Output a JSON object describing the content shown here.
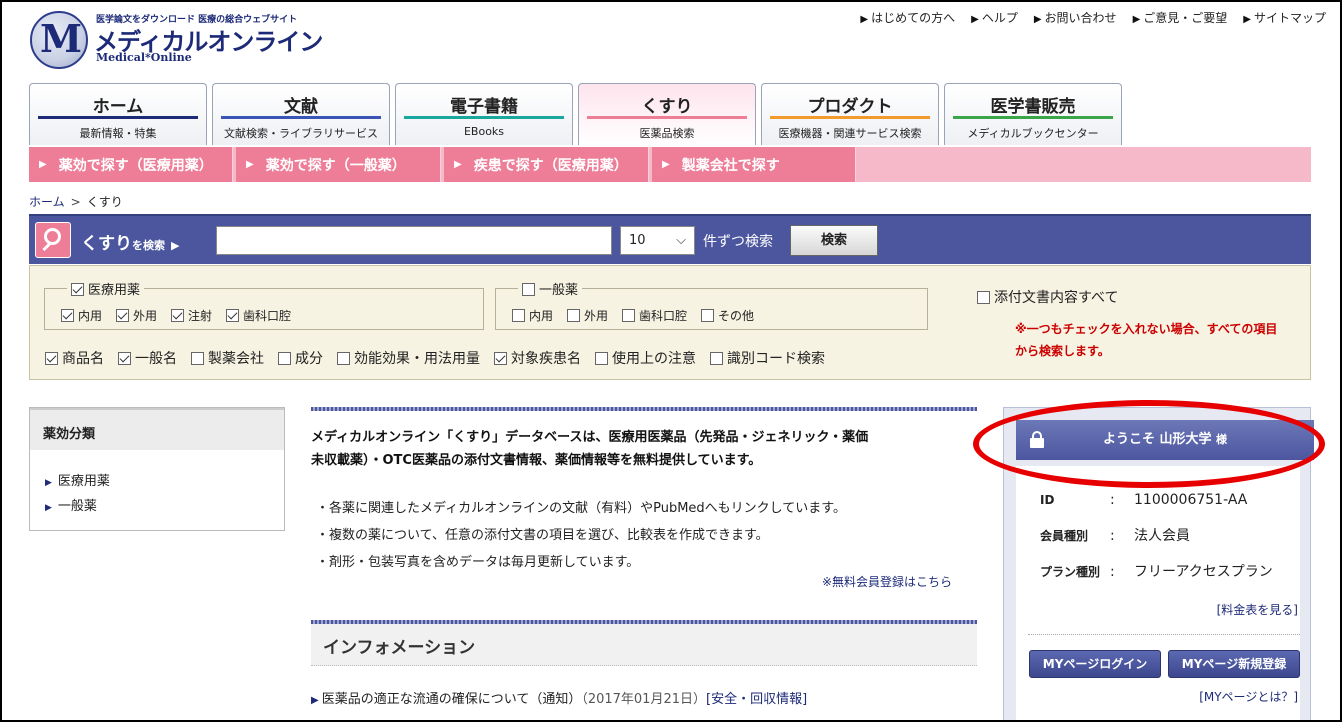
{
  "header": {
    "logo_letter": "M",
    "tagline": "医学論文をダウンロード 医療の総合ウェブサイト",
    "site_name": "メディカルオンライン",
    "site_name_en": "Medical*Online",
    "top_links": [
      "はじめての方へ",
      "ヘルプ",
      "お問い合わせ",
      "ご意見・ご要望",
      "サイトマップ"
    ]
  },
  "tabs": [
    {
      "label": "ホーム",
      "sub": "最新情報・特集",
      "color": "#1d2a78"
    },
    {
      "label": "文献",
      "sub": "文献検索・ライブラリサービス",
      "color": "#3b55b6"
    },
    {
      "label": "電子書籍",
      "sub": "EBooks",
      "color": "#1aa7a0"
    },
    {
      "label": "くすり",
      "sub": "医薬品検索",
      "color": "#ee7d97"
    },
    {
      "label": "プロダクト",
      "sub": "医療機器・関連サービス検索",
      "color": "#f39a2c"
    },
    {
      "label": "医学書販売",
      "sub": "メディカルブックセンター",
      "color": "#3aa54a"
    }
  ],
  "subnav": [
    "薬効で探す（医療用薬）",
    "薬効で探す（一般薬）",
    "疾患で探す（医療用薬）",
    "製薬会社で探す"
  ],
  "breadcrumb": {
    "home": "ホーム",
    "sep": ">",
    "current": "くすり"
  },
  "search": {
    "title": "くすり",
    "title_suffix": "を検索",
    "value": "",
    "count": "10",
    "unit": "件ずつ検索",
    "button": "検索"
  },
  "filters": {
    "iryo": {
      "label": "医療用薬",
      "checked": true,
      "options": [
        {
          "label": "内用",
          "checked": true
        },
        {
          "label": "外用",
          "checked": true
        },
        {
          "label": "注射",
          "checked": true
        },
        {
          "label": "歯科口腔",
          "checked": true
        }
      ]
    },
    "ippan": {
      "label": "一般薬",
      "checked": false,
      "options": [
        {
          "label": "内用",
          "checked": false
        },
        {
          "label": "外用",
          "checked": false
        },
        {
          "label": "歯科口腔",
          "checked": false
        },
        {
          "label": "その他",
          "checked": false
        }
      ]
    },
    "fields": [
      {
        "label": "商品名",
        "checked": true
      },
      {
        "label": "一般名",
        "checked": true
      },
      {
        "label": "製薬会社",
        "checked": false
      },
      {
        "label": "成分",
        "checked": false
      },
      {
        "label": "効能効果・用法用量",
        "checked": false
      },
      {
        "label": "対象疾患名",
        "checked": true
      },
      {
        "label": "使用上の注意",
        "checked": false
      },
      {
        "label": "識別コード検索",
        "checked": false
      }
    ],
    "attach_all": {
      "label": "添付文書内容すべて",
      "checked": false
    },
    "note_line1": "※一つもチェックを入れない場合、すべての項目",
    "note_line2": "から検索します。"
  },
  "sidebar": {
    "title": "薬効分類",
    "items": [
      "医療用薬",
      "一般薬"
    ]
  },
  "main": {
    "intro_line1": "メディカルオンライン「くすり」データベースは、医療用医薬品（先発品・ジェネリック・薬価",
    "intro_line2": "未収載薬）・OTC医薬品の添付文書情報、薬価情報等を無料提供しています。",
    "bullets": [
      "・各薬に関連したメディカルオンラインの文献（有料）やPubMedへもリンクしています。",
      "・複数の薬について、任意の添付文書の項目を選び、比較表を作成できます。",
      "・剤形・包装写真を含めデータは毎月更新しています。"
    ],
    "register_link": "※無料会員登録はこちら",
    "info_title": "インフォメーション",
    "news": [
      {
        "title": "医薬品の適正な流通の確保について（通知）",
        "date": "（2017年01月21日）",
        "tag": "[安全・回収情報]"
      }
    ]
  },
  "account": {
    "welcome_prefix": "ようこそ",
    "user": "山形大学",
    "honorific": "様",
    "id_label": "ID",
    "id_value": "1100006751-AA",
    "member_label": "会員種別",
    "member_value": "法人会員",
    "plan_label": "プラン種別",
    "plan_value": "フリーアクセスプラン",
    "colon": ":",
    "fee_link": "[料金表を見る]",
    "login_button": "MYページログイン",
    "register_button": "MYページ新規登録",
    "mypage_link": "[MYページとは？]"
  },
  "colors": {
    "accent": "#4b569f",
    "pink": "#ee7d97",
    "highlight": "#e60000"
  }
}
